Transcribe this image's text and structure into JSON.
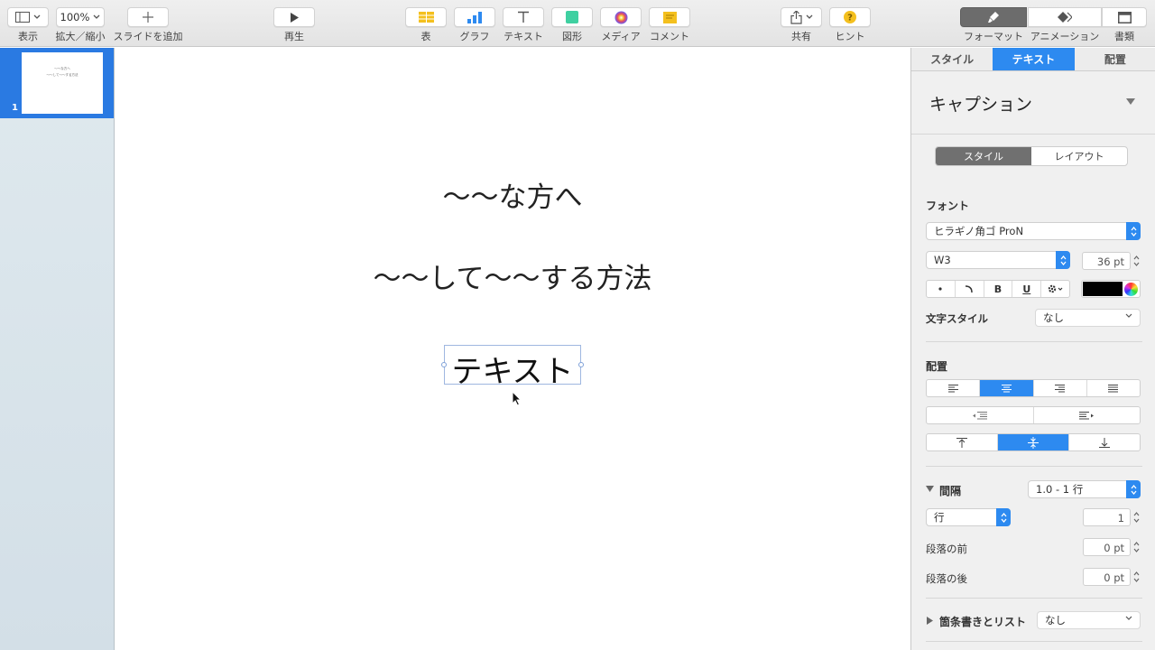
{
  "toolbar": {
    "view_label": "表示",
    "zoom_value": "100%",
    "zoom_label": "拡大／縮小",
    "add_slide_label": "スライドを追加",
    "play_label": "再生",
    "table_label": "表",
    "chart_label": "グラフ",
    "text_label": "テキスト",
    "shape_label": "図形",
    "media_label": "メディア",
    "comment_label": "コメント",
    "share_label": "共有",
    "tips_label": "ヒント",
    "format_label": "フォーマット",
    "animate_label": "アニメーション",
    "document_label": "書類",
    "accent_color": "#2d8af0"
  },
  "navigator": {
    "slide_number": "1",
    "thumb_line_1": "〜〜な方へ",
    "thumb_line_2": "〜〜して〜〜する方法"
  },
  "slide": {
    "title": "〜〜な方へ",
    "subtitle": "〜〜して〜〜する方法",
    "caption": "テキスト"
  },
  "inspector": {
    "tabs": [
      "スタイル",
      "テキスト",
      "配置"
    ],
    "active_tab": "テキスト",
    "paragraph_style": "キャプション",
    "sub_tabs": [
      "スタイル",
      "レイアウト"
    ],
    "font_section": "フォント",
    "font_family": "ヒラギノ角ゴ ProN",
    "font_weight": "W3",
    "font_size": "36 pt",
    "bold_label": "B",
    "underline_label": "U",
    "text_color": "#000000",
    "char_style_label": "文字スタイル",
    "char_style_value": "なし",
    "alignment_section": "配置",
    "spacing_section": "間隔",
    "spacing_value": "1.0 - 1 行",
    "line_unit": "行",
    "line_value": "1",
    "before_label": "段落の前",
    "before_value": "0 pt",
    "after_label": "段落の後",
    "after_value": "0 pt",
    "bullets_section": "箇条書きとリスト",
    "bullets_value": "なし"
  }
}
